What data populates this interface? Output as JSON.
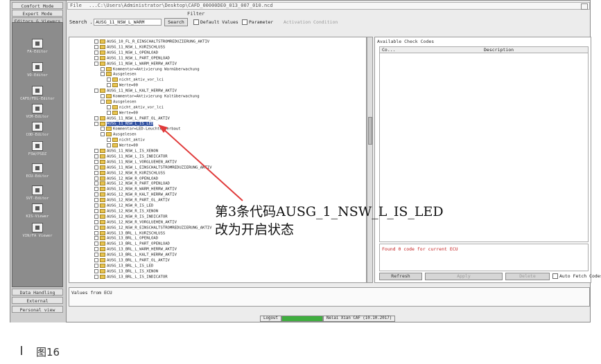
{
  "left_panel": {
    "top_buttons": [
      "Comfort Mode",
      "Expert Mode",
      "Editors & Viewers"
    ],
    "tools": [
      "FA-Editor",
      "VO-Editor",
      "CAFD/FDL-Editor",
      "VCM-Editor",
      "COD-Editor",
      "FSW/PSDZ",
      "ECU-Editor",
      "SVT-Editor",
      "KIS-Viewer",
      "VIN/FA Viewer"
    ],
    "bottom_buttons": [
      "Data Handling",
      "External Applicat..",
      "Personal view"
    ]
  },
  "file_row": {
    "label": "File",
    "path": "...C:\\Users\\Administrator\\Desktop\\CAFD_00000DE0_013_007_010.ncd"
  },
  "filter": {
    "title": "Filter",
    "search_label": "Search ...",
    "search_value": "AUSG_11_NSW_L_WARM",
    "search_button": "Search",
    "default_values": "Default Values",
    "parameter": "Parameter",
    "activation_condition": "Activation Condition"
  },
  "tree": [
    "AUSG_10_FL_R_EINSCHALTSTROMREDUZIERUNG_AKTIV",
    "AUSG_11_NSW_L_KURZSCHLUSS",
    "AUSG_11_NSW_L_OPENLOAD",
    "AUSG_11_NSW_L_PART_OPENLOAD",
    "AUSG_11_NSW_L_WARM_HERRW_AKTIV",
    "Kommentar=Aktivierung Warmüberwachung",
    "Ausgelesen",
    "nicht_aktiv_vor_lci",
    "Werte=00",
    "AUSG_11_NSW_L_KALT_HERRW_AKTIV",
    "Kommentar=Aktivierung Kaltüberwachung",
    "Ausgelesen",
    "nicht_aktiv_vor_lci",
    "Werte=00",
    "AUSG_11_NSW_L_PART_OL_AKTIV",
    "AUSG_11_NSW_L_IS_LED",
    "Kommentar=LED-Leuchte verbaut",
    "Ausgelesen",
    "nicht_aktiv",
    "Werte=00",
    "AUSG_11_NSW_L_IS_XENON",
    "AUSG_11_NSW_L_IS_INDICATOR",
    "AUSG_11_NSW_L_VORGLUEHEN_AKTIV",
    "AUSG_11_NSW_L_EINSCHALTSTROMREDUZIERUNG_AKTIV",
    "AUSG_12_NSW_R_KURZSCHLUSS",
    "AUSG_12_NSW_R_OPENLOAD",
    "AUSG_12_NSW_R_PART_OPENLOAD",
    "AUSG_12_NSW_R_WARM_HERRW_AKTIV",
    "AUSG_12_NSW_R_KALT_HERRW_AKTIV",
    "AUSG_12_NSW_R_PART_OL_AKTIV",
    "AUSG_12_NSW_R_IS_LED",
    "AUSG_12_NSW_R_IS_XENON",
    "AUSG_12_NSW_R_IS_INDICATOR",
    "AUSG_12_NSW_R_VORGLUEHEN_AKTIV",
    "AUSG_12_NSW_R_EINSCHALTSTROMREDUZIERUNG_AKTIV",
    "AUSG_13_BRL_L_KURZSCHLUSS",
    "AUSG_13_BRL_L_OPENLOAD",
    "AUSG_13_BRL_L_PART_OPENLOAD",
    "AUSG_13_BRL_L_WARM_HERRW_AKTIV",
    "AUSG_13_BRL_L_KALT_HERRW_AKTIV",
    "AUSG_13_BRL_L_PART_OL_AKTIV",
    "AUSG_13_BRL_L_IS_LED",
    "AUSG_13_BRL_L_IS_XENON",
    "AUSG_13_BRL_L_IS_INDICATOR"
  ],
  "codes_panel": {
    "title": "Available Check Codes",
    "col_code": "Co...",
    "col_description": "Description",
    "status": "Found 0 code for current ECU",
    "refresh": "Refresh",
    "apply": "Apply",
    "delete": "Delete",
    "auto_fetch": "Auto Fetch Codes"
  },
  "values_label": "Values from ECU",
  "statusbar": {
    "mode": "Logout",
    "app": "Nelai Xian CAF (10.10.2017)"
  },
  "annotation": {
    "line1": "第3条代码AUSG_1_NSW_L_IS_LED",
    "line2": "改为开启状态"
  },
  "figure_caption": "图16",
  "colors": {
    "selection": "#2f4f9f",
    "arrow": "#e03a3a",
    "status_text": "#c42020"
  }
}
